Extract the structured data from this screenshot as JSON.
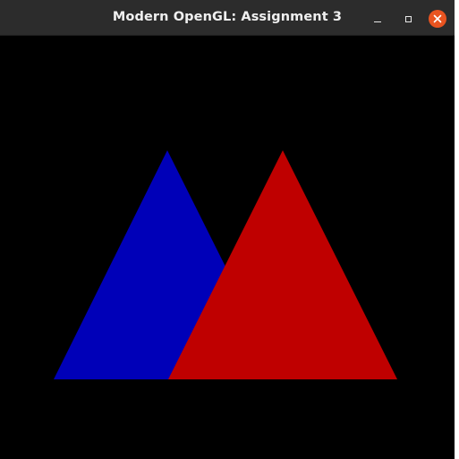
{
  "window": {
    "title": "Modern OpenGL: Assignment 3"
  },
  "controls": {
    "minimize_icon": "minimize-icon",
    "maximize_icon": "maximize-icon",
    "close_icon": "close-icon",
    "close_color": "#e95420"
  },
  "scene": {
    "background": "#000000",
    "triangles": [
      {
        "name": "blue-triangle",
        "color": "#0000b8"
      },
      {
        "name": "red-triangle",
        "color": "#bf0000"
      }
    ]
  }
}
